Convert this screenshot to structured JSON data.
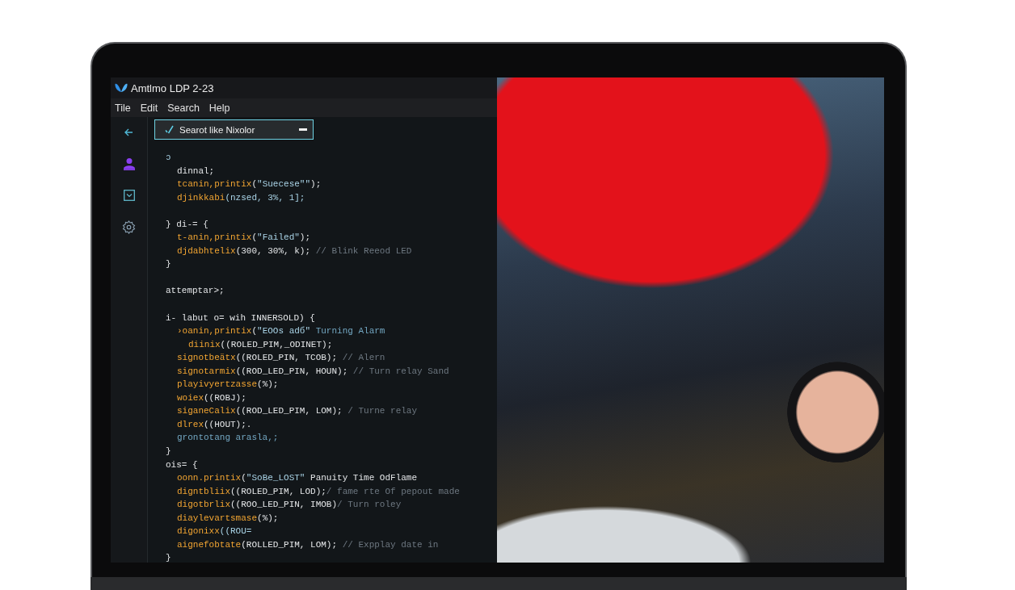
{
  "window": {
    "title": "Amtlmo LDP 2-23"
  },
  "menu": [
    "Tile",
    "Edit",
    "Search",
    "Help"
  ],
  "search": {
    "value": "Searot like Nixolor"
  },
  "editor": {
    "lines": [
      {
        "kind": "code",
        "tokens": [
          {
            "kind": "string",
            "text": "ↄ"
          }
        ],
        "children": [
          {
            "tokens": [
              {
                "kind": "plain",
                "text": "dinnal;"
              }
            ]
          },
          {
            "tokens": [
              {
                "kind": "fn",
                "text": "tcanin,printix"
              },
              {
                "kind": "plain",
                "text": "("
              },
              {
                "kind": "string",
                "text": "\"Suecese\"\""
              },
              {
                "kind": "plain",
                "text": ");"
              }
            ]
          },
          {
            "tokens": [
              {
                "kind": "fn",
                "text": "djinkkabi"
              },
              {
                "kind": "string",
                "text": "(nzsed, 3%, 1];"
              }
            ]
          }
        ]
      },
      {
        "kind": "blank"
      },
      {
        "kind": "code",
        "tokens": [
          {
            "kind": "plain",
            "text": "} di-= {"
          }
        ],
        "children": [
          {
            "tokens": [
              {
                "kind": "fn",
                "text": "t-anin,printix"
              },
              {
                "kind": "plain",
                "text": "("
              },
              {
                "kind": "string",
                "text": "\"Failed\""
              },
              {
                "kind": "plain",
                "text": ");"
              }
            ]
          },
          {
            "tokens": [
              {
                "kind": "fn",
                "text": "djdabhtelix"
              },
              {
                "kind": "plain",
                "text": "(300, 30%, k);"
              },
              {
                "kind": "comment",
                "text": " // Blink Reeod LED"
              }
            ]
          }
        ]
      },
      {
        "kind": "code",
        "tokens": [
          {
            "kind": "plain",
            "text": "}"
          }
        ]
      },
      {
        "kind": "blank"
      },
      {
        "kind": "code",
        "tokens": [
          {
            "kind": "plain",
            "text": "attemptar>;"
          }
        ]
      },
      {
        "kind": "blank"
      },
      {
        "kind": "code",
        "tokens": [
          {
            "kind": "plain",
            "text": "i- labut o= wih INNERSOLD) {"
          }
        ],
        "children": [
          {
            "tokens": [
              {
                "kind": "fn",
                "text": "›oanin,printix"
              },
              {
                "kind": "plain",
                "text": "("
              },
              {
                "kind": "string",
                "text": "\"EOOs adб\""
              },
              {
                "kind": "note",
                "text": " Turning Alarm"
              }
            ],
            "children": [
              {
                "tokens": [
                  {
                    "kind": "fn",
                    "text": "diinix"
                  },
                  {
                    "kind": "plain",
                    "text": "((ROLED_PIM,_ODINET);"
                  }
                ]
              }
            ]
          },
          {
            "tokens": [
              {
                "kind": "fn",
                "text": "signotbeätx"
              },
              {
                "kind": "plain",
                "text": "((ROLED_PIN, TCOB);"
              },
              {
                "kind": "comment",
                "text": " // Alern"
              }
            ]
          },
          {
            "tokens": [
              {
                "kind": "fn",
                "text": "signotarmix"
              },
              {
                "kind": "plain",
                "text": "((ROD_LED_PIN, HOUN);"
              },
              {
                "kind": "comment",
                "text": " // Turn relay Sand"
              }
            ]
          },
          {
            "tokens": [
              {
                "kind": "fn",
                "text": "playivyertzasse"
              },
              {
                "kind": "plain",
                "text": "(%);"
              }
            ]
          },
          {
            "tokens": [
              {
                "kind": "fn",
                "text": "woiex"
              },
              {
                "kind": "plain",
                "text": "((ROBJ);"
              }
            ]
          },
          {
            "tokens": [
              {
                "kind": "fn",
                "text": "siganeCalix"
              },
              {
                "kind": "plain",
                "text": "((ROD_LED_PIM, LOM);"
              },
              {
                "kind": "comment",
                "text": " / Turne relay"
              }
            ]
          },
          {
            "tokens": [
              {
                "kind": "fn",
                "text": "dlrex"
              },
              {
                "kind": "plain",
                "text": "((HOUT);."
              }
            ]
          },
          {
            "tokens": [
              {
                "kind": "note",
                "text": "grontotang arasla,;"
              }
            ]
          }
        ]
      },
      {
        "kind": "code",
        "tokens": [
          {
            "kind": "plain",
            "text": "}"
          }
        ]
      },
      {
        "kind": "code",
        "tokens": [
          {
            "kind": "plain",
            "text": "ois= {"
          }
        ],
        "children": [
          {
            "tokens": [
              {
                "kind": "fn",
                "text": "oonn.printix"
              },
              {
                "kind": "plain",
                "text": "("
              },
              {
                "kind": "string",
                "text": "\"SoBe_LOST\""
              },
              {
                "kind": "plain",
                "text": " Panuity Time OdFlame"
              }
            ]
          },
          {
            "tokens": [
              {
                "kind": "fn",
                "text": "digntbliix"
              },
              {
                "kind": "plain",
                "text": "((ROLED_PIM, LOD);"
              },
              {
                "kind": "comment",
                "text": "/ fame rte Of pepout made"
              }
            ]
          },
          {
            "tokens": [
              {
                "kind": "fn",
                "text": "digotbrlix"
              },
              {
                "kind": "plain",
                "text": "((ROO_LED_PIN, IMOB)"
              },
              {
                "kind": "comment",
                "text": "/ Turn roley"
              }
            ]
          },
          {
            "tokens": [
              {
                "kind": "fn",
                "text": "diaylevartsmase"
              },
              {
                "kind": "plain",
                "text": "(%);"
              }
            ]
          },
          {
            "tokens": [
              {
                "kind": "fn",
                "text": "digonixx"
              },
              {
                "kind": "string",
                "text": "((ROU="
              }
            ]
          },
          {
            "tokens": [
              {
                "kind": "fn",
                "text": "aignefobtate"
              },
              {
                "kind": "plain",
                "text": "(ROLLED_PIM, LOM);"
              },
              {
                "kind": "comment",
                "text": " // Expplay date in"
              }
            ]
          }
        ]
      },
      {
        "kind": "code",
        "tokens": [
          {
            "kind": "plain",
            "text": "}"
          }
        ]
      }
    ]
  }
}
